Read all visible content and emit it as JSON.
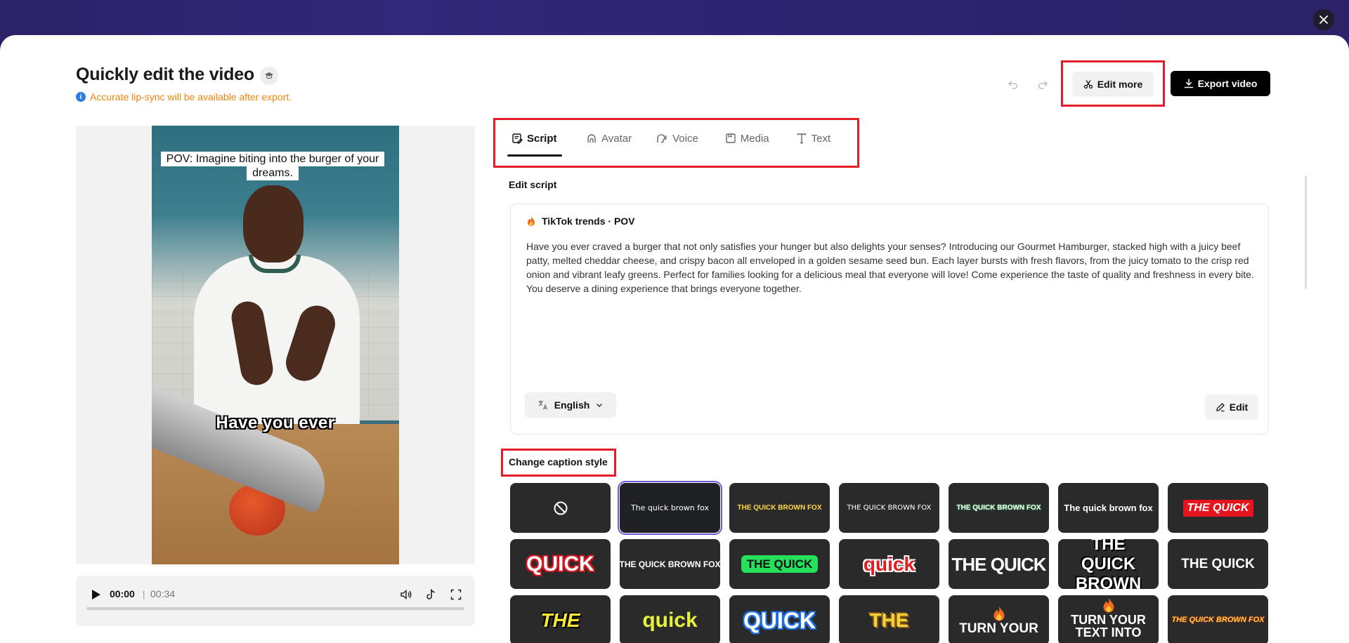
{
  "window": {
    "close_icon": "close-icon"
  },
  "header": {
    "title": "Quickly edit the video",
    "notice": "Accurate lip-sync will be available after export.",
    "edit_more_label": "Edit more",
    "export_label": "Export video"
  },
  "preview": {
    "top_caption": "POV: Imagine biting into the burger of your dreams.",
    "subtitle": "Have you ever",
    "player": {
      "current_time": "00:00",
      "separator": "|",
      "duration": "00:34",
      "progress": 0
    }
  },
  "tabs": [
    {
      "label": "Script",
      "icon": "script-icon",
      "active": true
    },
    {
      "label": "Avatar",
      "icon": "avatar-icon",
      "active": false
    },
    {
      "label": "Voice",
      "icon": "voice-icon",
      "active": false
    },
    {
      "label": "Media",
      "icon": "media-icon",
      "active": false
    },
    {
      "label": "Text",
      "icon": "text-icon",
      "active": false
    }
  ],
  "script": {
    "section_label": "Edit script",
    "template": "TikTok trends · POV",
    "body": "Have you ever craved a burger that not only satisfies your hunger but also delights your senses? Introducing our Gourmet Hamburger, stacked high with a juicy beef patty, melted cheddar cheese, and crispy bacon all enveloped in a golden sesame seed bun. Each layer bursts with fresh flavors, from the juicy tomato to the crisp red onion and vibrant leafy greens. Perfect for families looking for a delicious meal that everyone will love! Come experience the taste of quality and freshness in every bite. You deserve a dining experience that brings everyone together.",
    "language": "English",
    "edit_label": "Edit"
  },
  "captions": {
    "section_label": "Change caption style",
    "styles": [
      {
        "text": "",
        "kind": "none"
      },
      {
        "text": "The quick brown fox",
        "kind": "s1"
      },
      {
        "text": "THE QUICK BROWN FOX",
        "kind": "s2"
      },
      {
        "text": "THE QUICK BROWN FOX",
        "kind": "s3"
      },
      {
        "text": "THE QUICK BROWN FOX",
        "kind": "s4"
      },
      {
        "text": "The quick brown fox",
        "kind": "s5"
      },
      {
        "text": "THE QUICK",
        "kind": "s6"
      },
      {
        "text": "QUICK",
        "kind": "s7"
      },
      {
        "text": "THE QUICK BROWN FOX",
        "kind": "s8"
      },
      {
        "text": "THE QUICK",
        "kind": "s9"
      },
      {
        "text": "quick",
        "kind": "s10"
      },
      {
        "text": "THE QUICK",
        "kind": "s11"
      },
      {
        "text": "THE QUICK BROWN",
        "kind": "s12"
      },
      {
        "text": "THE QUICK",
        "kind": "s13"
      },
      {
        "text": "THE",
        "kind": "s14"
      },
      {
        "text": "quick",
        "kind": "s15"
      },
      {
        "text": "QUICK",
        "kind": "s16"
      },
      {
        "text": "THE",
        "kind": "s17"
      },
      {
        "text": "TURN YOUR",
        "kind": "s18"
      },
      {
        "text": "TURN YOUR TEXT INTO",
        "kind": "s19"
      },
      {
        "text": "THE QUICK BROWN FOX",
        "kind": "s20"
      }
    ]
  },
  "colors": {
    "accent_red": "#e41d2b",
    "notice_orange": "#f0850f",
    "selected_outline": "#6b5cd6"
  }
}
